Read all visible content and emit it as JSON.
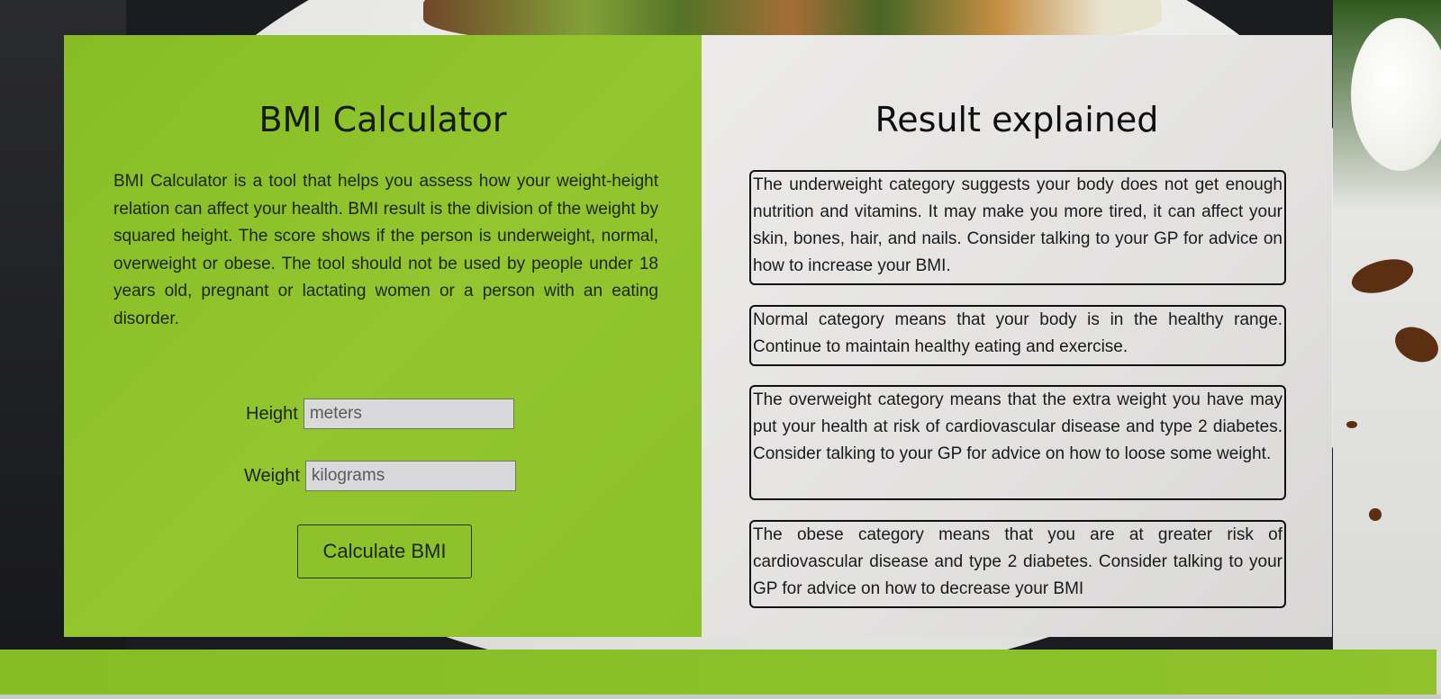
{
  "left": {
    "title": "BMI Calculator",
    "description": "BMI Calculator is a tool that helps you assess how your weight-height relation can affect your health. BMI result is the division of the weight by squared height. The score shows if the person is underweight, normal, overweight or obese. The tool should not be used by people under 18 years old, pregnant or lactating women or a person with an eating disorder.",
    "height_label": "Height",
    "height_placeholder": "meters",
    "weight_label": "Weight",
    "weight_placeholder": "kilograms",
    "button_label": "Calculate BMI"
  },
  "right": {
    "title": "Result explained",
    "results": [
      "The underweight category suggests your body does not get enough nutrition and vitamins. It may make you more tired, it can affect your skin, bones, hair, and nails. Consider talking to your GP for advice on how to increase your BMI.",
      "Normal category means that your body is in the healthy range. Continue to maintain healthy eating and exercise.",
      "The overweight category means that the extra weight you have may put your health at risk of cardiovascular disease and type 2 diabetes. Consider talking to your GP for advice on how to loose some weight.",
      "The obese category means that you are at greater risk of cardiovascular disease and type 2 diabetes. Consider talking to your GP for advice on how to decrease your BMI"
    ]
  },
  "colors": {
    "panel_green": "#8cc12a",
    "panel_light": "#e6e5e4",
    "text_dark": "#1c2515"
  }
}
